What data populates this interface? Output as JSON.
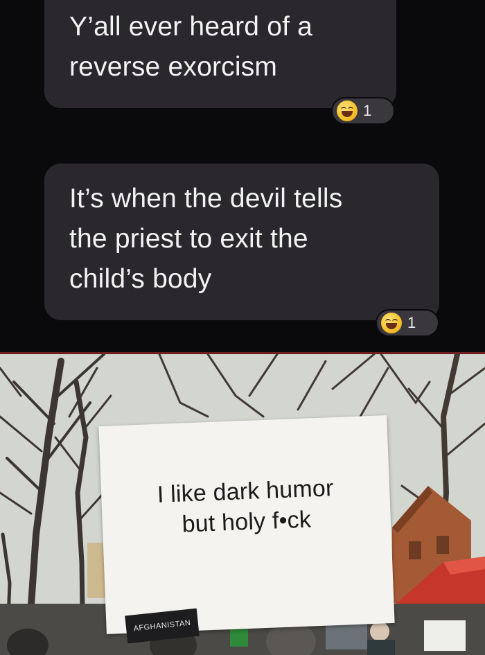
{
  "chat": {
    "message_1": {
      "lines": [
        "Y’all ever heard of a",
        "reverse exorcism"
      ],
      "reaction": {
        "icon": "laughing-emoji-icon",
        "count": "1"
      }
    },
    "message_2": {
      "lines": [
        "It’s when the devil tells",
        "the priest to exit the",
        "child’s body"
      ],
      "reaction": {
        "icon": "laughing-emoji-icon",
        "count": "1"
      }
    }
  },
  "photo": {
    "sign": {
      "lines": [
        "I like dark humor",
        "but holy f•ck"
      ]
    },
    "placard_text": "AFGHANISTAN"
  },
  "colors": {
    "chat_background": "#0a090c",
    "bubble": "#2a282d",
    "bubble_text": "#f3f3f3",
    "separator": "#6e1f1f"
  }
}
